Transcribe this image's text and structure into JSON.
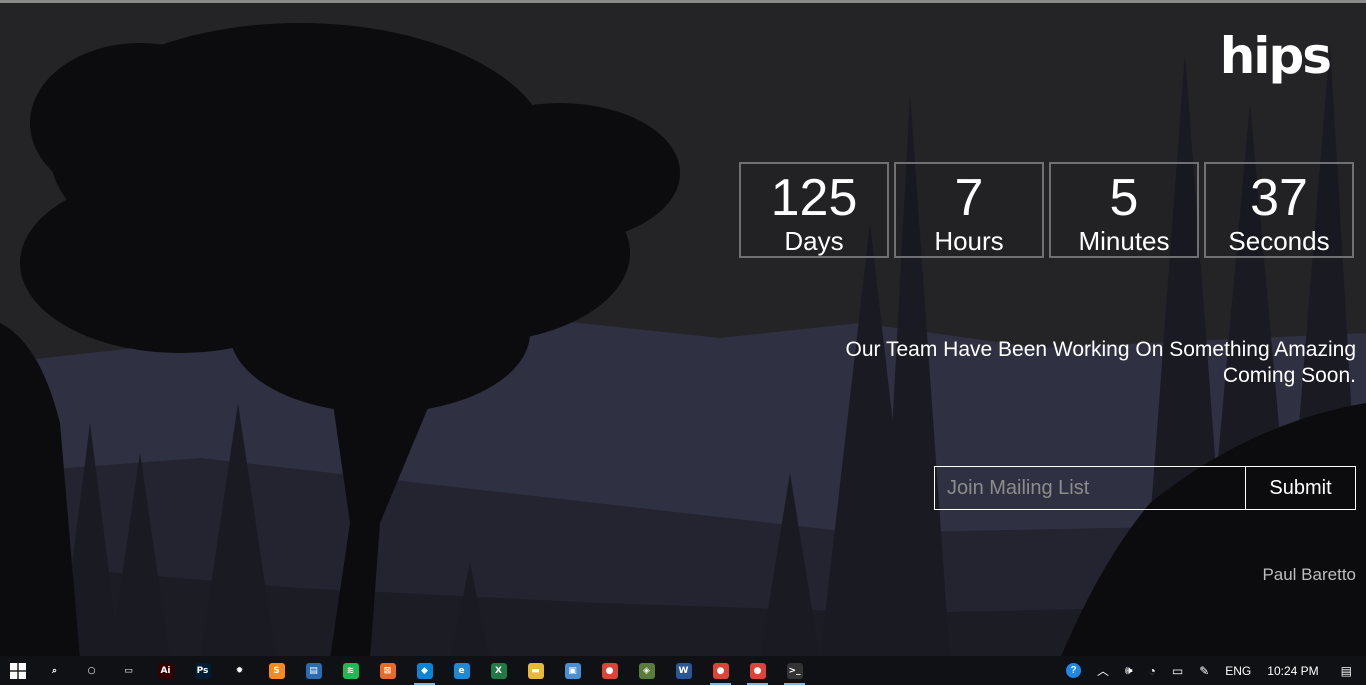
{
  "brand": {
    "logo": "hips"
  },
  "countdown": [
    {
      "value": "125",
      "label": "Days"
    },
    {
      "value": "7",
      "label": "Hours"
    },
    {
      "value": "5",
      "label": "Minutes"
    },
    {
      "value": "37",
      "label": "Seconds"
    }
  ],
  "tagline": {
    "line1": "Our Team Have Been Working On Something Amazing",
    "line2": "Coming Soon."
  },
  "mailing": {
    "placeholder": "Join Mailing List",
    "submit_label": "Submit"
  },
  "author": "Paul Baretto",
  "taskbar": {
    "apps": [
      {
        "name": "search-icon",
        "glyph": "⌕",
        "color": "transparent",
        "active": false
      },
      {
        "name": "cortana-icon",
        "glyph": "○",
        "color": "transparent",
        "active": false
      },
      {
        "name": "task-view-icon",
        "glyph": "▭",
        "color": "transparent",
        "active": false
      },
      {
        "name": "illustrator-icon",
        "glyph": "Ai",
        "color": "#330000",
        "active": false
      },
      {
        "name": "photoshop-icon",
        "glyph": "Ps",
        "color": "#001d34",
        "active": false
      },
      {
        "name": "app-orange-icon",
        "glyph": "✹",
        "color": "transparent",
        "active": false
      },
      {
        "name": "sublime-icon",
        "glyph": "S",
        "color": "#f58a1f",
        "active": false
      },
      {
        "name": "window-app-icon",
        "glyph": "▤",
        "color": "#2b6cb0",
        "active": false
      },
      {
        "name": "spotify-icon",
        "glyph": "≋",
        "color": "#1db954",
        "active": false
      },
      {
        "name": "app-box-icon",
        "glyph": "⊠",
        "color": "#e86a2b",
        "active": false
      },
      {
        "name": "vscode-icon",
        "glyph": "◆",
        "color": "#0a84d6",
        "active": true
      },
      {
        "name": "edge-icon",
        "glyph": "e",
        "color": "#1c8ad6",
        "active": false
      },
      {
        "name": "excel-icon",
        "glyph": "X",
        "color": "#1f7a45",
        "active": false
      },
      {
        "name": "file-explorer-icon",
        "glyph": "▬",
        "color": "#e8b83a",
        "active": false
      },
      {
        "name": "app-pkg-icon",
        "glyph": "▣",
        "color": "#4a8fd4",
        "active": false
      },
      {
        "name": "chrome-icon",
        "glyph": "●",
        "color": "#db4437",
        "active": false
      },
      {
        "name": "git-icon",
        "glyph": "◈",
        "color": "#5a7c3a",
        "active": false
      },
      {
        "name": "word-icon",
        "glyph": "W",
        "color": "#2b5797",
        "active": false
      },
      {
        "name": "chrome-icon-2",
        "glyph": "●",
        "color": "#db4437",
        "active": true
      },
      {
        "name": "chrome-icon-3",
        "glyph": "●",
        "color": "#db4437",
        "active": true
      },
      {
        "name": "terminal-icon",
        "glyph": ">_",
        "color": "#333333",
        "active": true
      }
    ],
    "tray": {
      "language": "ENG",
      "time": "10:24 PM"
    }
  }
}
